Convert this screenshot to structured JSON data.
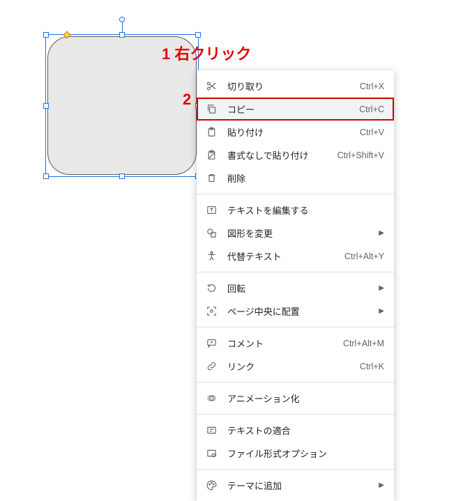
{
  "annotations": {
    "step1_num": "1",
    "step1_text": "右クリック",
    "step2_num": "2"
  },
  "menu": {
    "cut": {
      "label": "切り取り",
      "shortcut": "Ctrl+X"
    },
    "copy": {
      "label": "コピー",
      "shortcut": "Ctrl+C"
    },
    "paste": {
      "label": "貼り付け",
      "shortcut": "Ctrl+V"
    },
    "paste_unfmt": {
      "label": "書式なしで貼り付け",
      "shortcut": "Ctrl+Shift+V"
    },
    "delete": {
      "label": "削除",
      "shortcut": ""
    },
    "edit_text": {
      "label": "テキストを編集する",
      "shortcut": ""
    },
    "change_shape": {
      "label": "図形を変更",
      "shortcut": ""
    },
    "alt_text": {
      "label": "代替テキスト",
      "shortcut": "Ctrl+Alt+Y"
    },
    "rotate": {
      "label": "回転",
      "shortcut": ""
    },
    "center_page": {
      "label": "ページ中央に配置",
      "shortcut": ""
    },
    "comment": {
      "label": "コメント",
      "shortcut": "Ctrl+Alt+M"
    },
    "link": {
      "label": "リンク",
      "shortcut": "Ctrl+K"
    },
    "animate": {
      "label": "アニメーション化",
      "shortcut": ""
    },
    "fit_text": {
      "label": "テキストの適合",
      "shortcut": ""
    },
    "format_options": {
      "label": "ファイル形式オプション",
      "shortcut": ""
    },
    "add_theme": {
      "label": "テーマに追加",
      "shortcut": ""
    }
  }
}
